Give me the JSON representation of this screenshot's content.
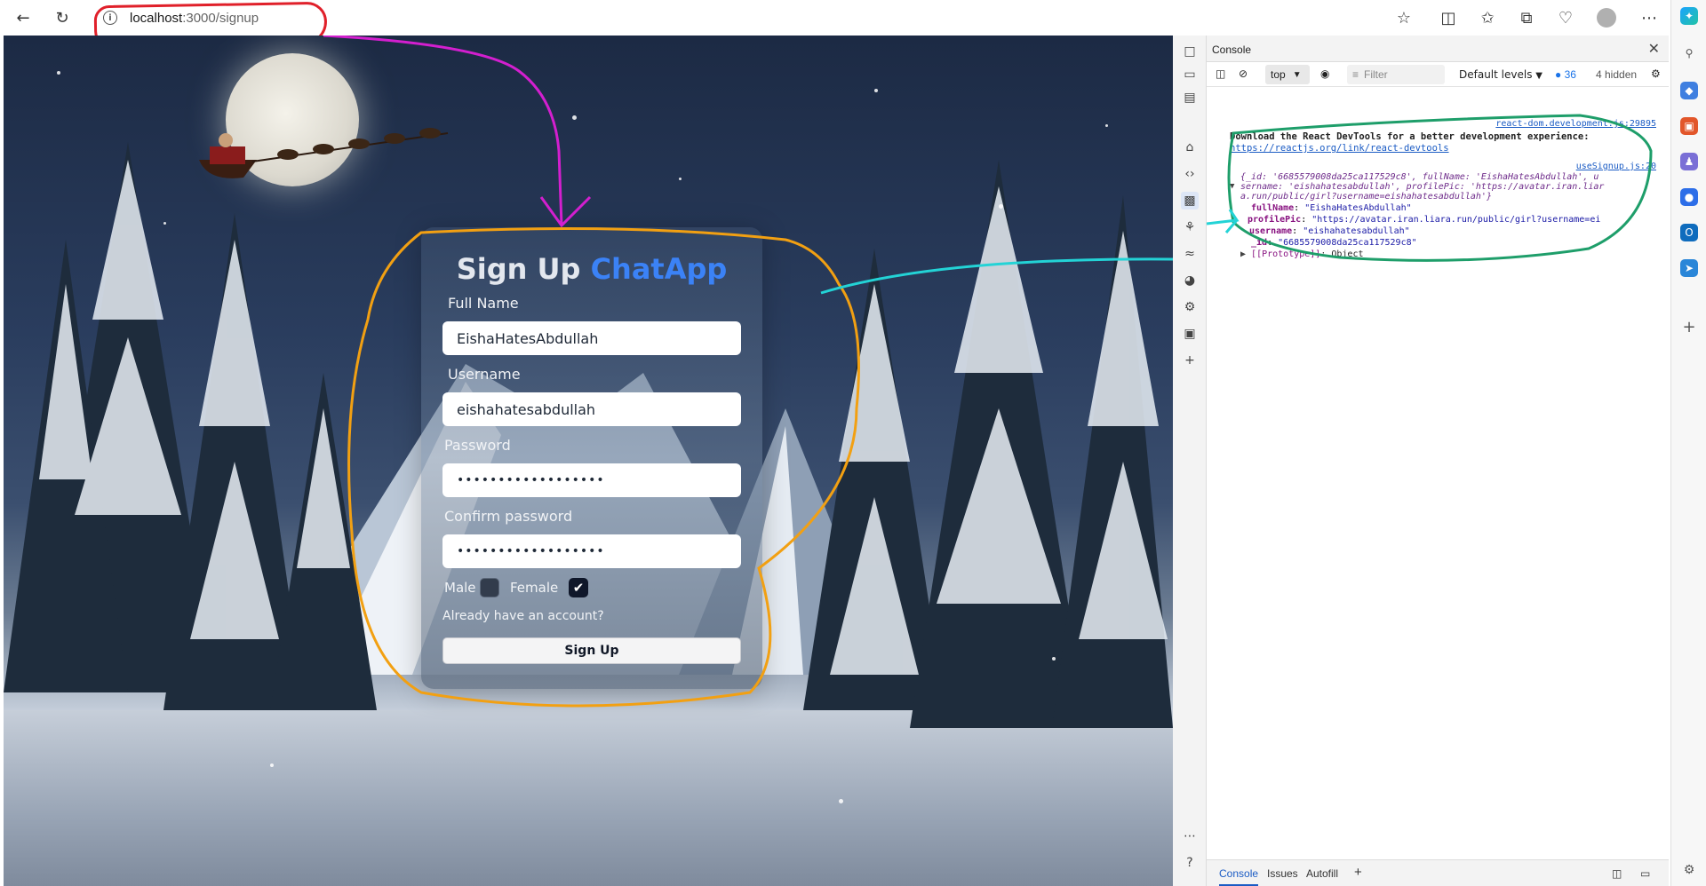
{
  "browser": {
    "url_host": "localhost",
    "url_path": ":3000/signup",
    "back_icon": "arrow-left-icon",
    "refresh_icon": "refresh-icon"
  },
  "signup": {
    "title_main": "Sign Up",
    "title_accent": "ChatApp",
    "accent_color": "#3b82f6",
    "full_name_label": "Full Name",
    "full_name_value": "EishaHatesAbdullah",
    "username_label": "Username",
    "username_value": "eishahatesabdullah",
    "password_label": "Password",
    "password_value": "••••••••••••••••••",
    "confirm_label": "Confirm password",
    "confirm_value": "••••••••••••••••••",
    "male_label": "Male",
    "female_label": "Female",
    "male_checked": false,
    "female_checked": true,
    "have_account": "Already have an account?",
    "signup_button": "Sign Up"
  },
  "devtools": {
    "panel_title": "Console",
    "context": "top",
    "filter_placeholder": "Filter",
    "levels": "Default levels",
    "message_count": "36",
    "hidden_count": "4 hidden",
    "log1_source": "react-dom.development.js:29895",
    "log1_text": "Download the React DevTools for a better development experience:",
    "log1_link": "https://reactjs.org/link/react-devtools",
    "log2_source": "useSignup.js:20",
    "log2_summary_1": "{_id: '6685579008da25ca117529c8', fullName: 'EishaHatesAbdullah', u",
    "log2_summary_2": "sername: 'eishahatesabdullah', profilePic: 'https://avatar.iran.liar",
    "log2_summary_3": "a.run/public/girl?username=eishahatesabdullah'}",
    "prop_fullname_key": "fullName",
    "prop_fullname_val": "\"EishaHatesAbdullah\"",
    "prop_pic_key": "profilePic",
    "prop_pic_val": "\"https://avatar.iran.liara.run/public/girl?username=ei",
    "prop_user_key": "username",
    "prop_user_val": "\"eishahatesabdullah\"",
    "prop_id_key": "_id",
    "prop_id_val": "\"6685579008da25ca117529c8\"",
    "prop_proto_key": "[[Prototype]]",
    "prop_proto_val": "Object",
    "footer_tabs": [
      "Console",
      "Issues",
      "Autofill"
    ]
  }
}
